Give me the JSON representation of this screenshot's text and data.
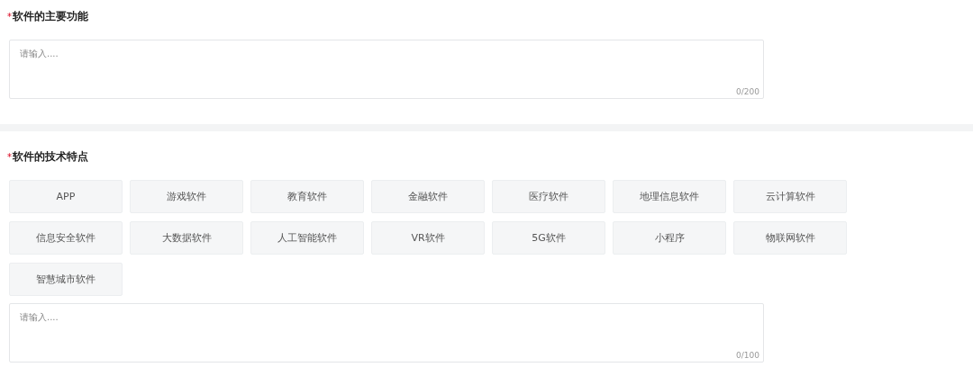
{
  "sections": [
    {
      "title": "软件的主要功能",
      "required_mark": "*",
      "field": {
        "placeholder": "请输入....",
        "counter": "0/200"
      }
    },
    {
      "title": "软件的技术特点",
      "required_mark": "*",
      "tags": [
        {
          "label": "APP",
          "selected": false
        },
        {
          "label": "游戏软件",
          "selected": false
        },
        {
          "label": "教育软件",
          "selected": false
        },
        {
          "label": "金融软件",
          "selected": false
        },
        {
          "label": "医疗软件",
          "selected": false
        },
        {
          "label": "地理信息软件",
          "selected": false
        },
        {
          "label": "云计算软件",
          "selected": false
        },
        {
          "label": "信息安全软件",
          "selected": false
        },
        {
          "label": "大数据软件",
          "selected": false
        },
        {
          "label": "人工智能软件",
          "selected": false
        },
        {
          "label": "VR软件",
          "selected": false
        },
        {
          "label": "5G软件",
          "selected": false
        },
        {
          "label": "小程序",
          "selected": false
        },
        {
          "label": "物联网软件",
          "selected": false
        },
        {
          "label": "智慧城市软件",
          "selected": false
        }
      ],
      "field": {
        "placeholder": "请输入....",
        "counter": "0/100"
      }
    }
  ]
}
